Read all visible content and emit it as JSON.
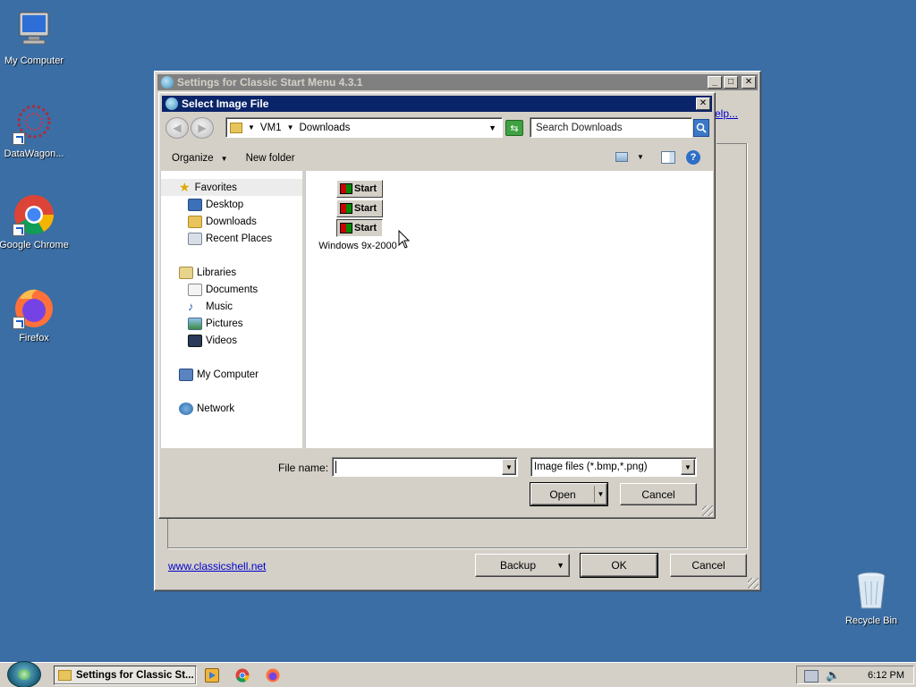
{
  "desktop": {
    "icons": [
      {
        "label": "My Computer"
      },
      {
        "label": "DataWagon..."
      },
      {
        "label": "Google Chrome"
      },
      {
        "label": "Firefox"
      },
      {
        "label": "Recycle Bin"
      }
    ]
  },
  "settings_window": {
    "title": "Settings for Classic Start Menu 4.3.1",
    "help_link": "elp...",
    "website_link": "www.classicshell.net",
    "buttons": {
      "backup": "Backup",
      "ok": "OK",
      "cancel": "Cancel"
    }
  },
  "dialog": {
    "title": "Select Image File",
    "breadcrumb": [
      "VM1",
      "Downloads"
    ],
    "search_placeholder": "Search Downloads",
    "toolbar": {
      "organize": "Organize",
      "new_folder": "New folder"
    },
    "nav": {
      "favorites": {
        "label": "Favorites",
        "items": [
          "Desktop",
          "Downloads",
          "Recent Places"
        ]
      },
      "libraries": {
        "label": "Libraries",
        "items": [
          "Documents",
          "Music",
          "Pictures",
          "Videos"
        ]
      },
      "computer": "My Computer",
      "network": "Network"
    },
    "file": {
      "name": "Windows 9x-2000",
      "thumb_text": "Start"
    },
    "file_name_label": "File name:",
    "file_name_value": "",
    "file_type": "Image files (*.bmp,*.png)",
    "open_button": "Open",
    "cancel_button": "Cancel"
  },
  "taskbar": {
    "active_task": "Settings for Classic St...",
    "clock": "6:12 PM"
  }
}
